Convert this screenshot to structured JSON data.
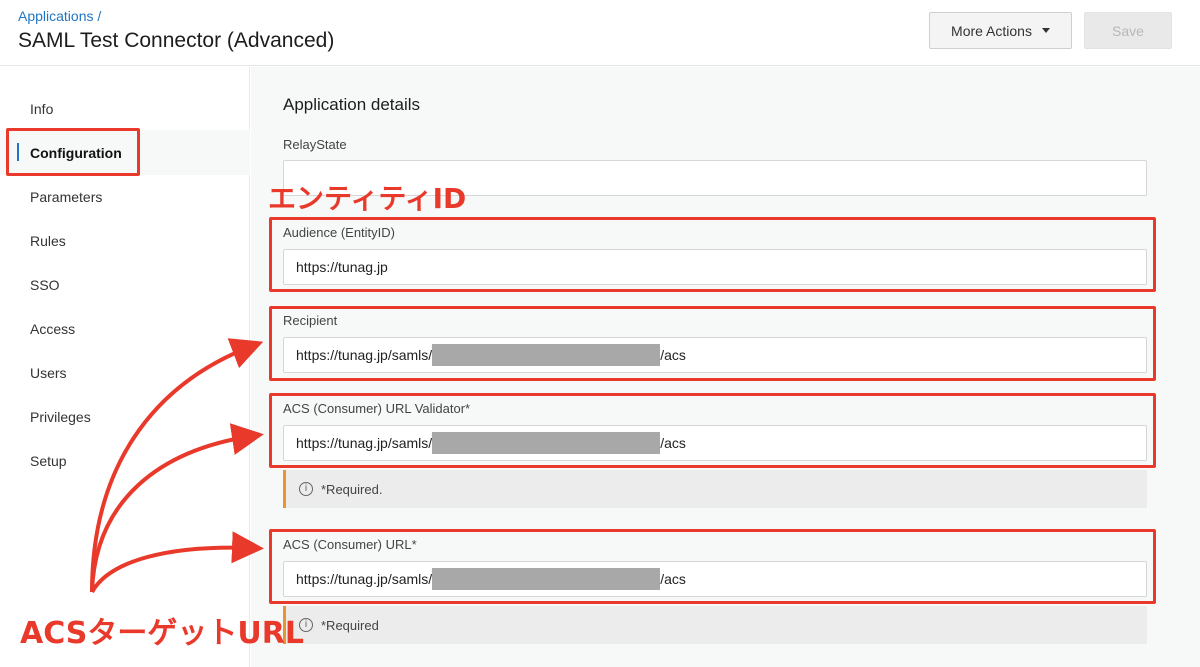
{
  "header": {
    "breadcrumb": "Applications /",
    "title": "SAML Test Connector (Advanced)",
    "more_actions_label": "More Actions",
    "save_label": "Save"
  },
  "sidebar": {
    "items": [
      {
        "label": "Info"
      },
      {
        "label": "Configuration",
        "active": true
      },
      {
        "label": "Parameters"
      },
      {
        "label": "Rules"
      },
      {
        "label": "SSO"
      },
      {
        "label": "Access"
      },
      {
        "label": "Users"
      },
      {
        "label": "Privileges"
      },
      {
        "label": "Setup"
      }
    ]
  },
  "main": {
    "section_title": "Application details",
    "fields": {
      "relay_state": {
        "label": "RelayState",
        "value": ""
      },
      "audience": {
        "label": "Audience (EntityID)",
        "value": "https://tunag.jp"
      },
      "recipient": {
        "label": "Recipient",
        "prefix": "https://tunag.jp/samls/",
        "suffix": "/acs"
      },
      "acs_validator": {
        "label": "ACS (Consumer) URL Validator*",
        "prefix": "https://tunag.jp/samls/",
        "suffix": "/acs",
        "notice": "*Required."
      },
      "acs_url": {
        "label": "ACS (Consumer) URL*",
        "prefix": "https://tunag.jp/samls/",
        "suffix": "/acs",
        "notice": "*Required"
      }
    }
  },
  "annotations": {
    "entity_id_label": "エンティティID",
    "acs_target_label": "ACSターゲットURL",
    "color": "#e8392b"
  }
}
